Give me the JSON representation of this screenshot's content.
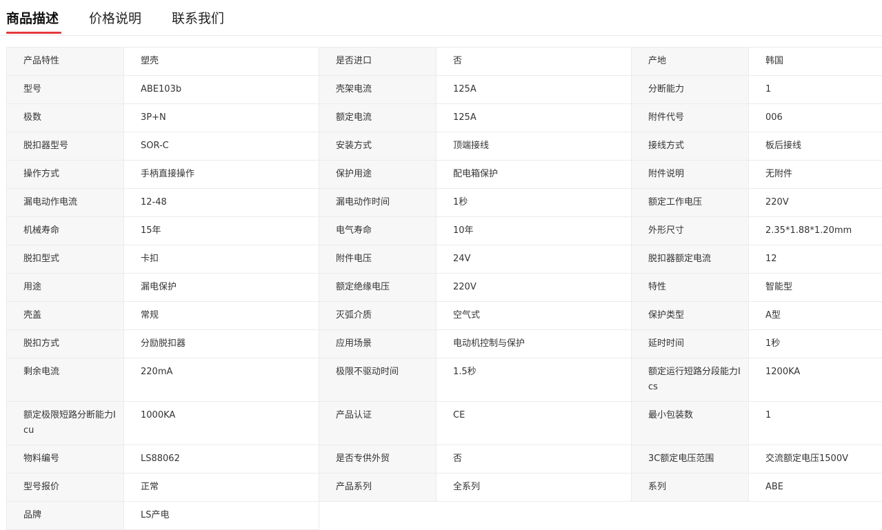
{
  "tabs": [
    {
      "label": "商品描述",
      "active": true
    },
    {
      "label": "价格说明",
      "active": false
    },
    {
      "label": "联系我们",
      "active": false
    }
  ],
  "accent_color": "#e4393c",
  "specs": [
    [
      [
        "产品特性",
        "塑壳"
      ],
      [
        "是否进口",
        "否"
      ],
      [
        "产地",
        "韩国"
      ]
    ],
    [
      [
        "型号",
        "ABE103b"
      ],
      [
        "壳架电流",
        "125A"
      ],
      [
        "分断能力",
        "1"
      ]
    ],
    [
      [
        "极数",
        "3P+N"
      ],
      [
        "额定电流",
        "125A"
      ],
      [
        "附件代号",
        "006"
      ]
    ],
    [
      [
        "脱扣器型号",
        "SOR-C"
      ],
      [
        "安装方式",
        "顶端接线"
      ],
      [
        "接线方式",
        "板后接线"
      ]
    ],
    [
      [
        "操作方式",
        "手柄直接操作"
      ],
      [
        "保护用途",
        "配电箱保护"
      ],
      [
        "附件说明",
        "无附件"
      ]
    ],
    [
      [
        "漏电动作电流",
        "12-48"
      ],
      [
        "漏电动作时间",
        "1秒"
      ],
      [
        "额定工作电压",
        "220V"
      ]
    ],
    [
      [
        "机械寿命",
        "15年"
      ],
      [
        "电气寿命",
        "10年"
      ],
      [
        "外形尺寸",
        "2.35*1.88*1.20mm"
      ]
    ],
    [
      [
        "脱扣型式",
        "卡扣"
      ],
      [
        "附件电压",
        "24V"
      ],
      [
        "脱扣器额定电流",
        "12"
      ]
    ],
    [
      [
        "用途",
        "漏电保护"
      ],
      [
        "额定绝缘电压",
        "220V"
      ],
      [
        "特性",
        "智能型"
      ]
    ],
    [
      [
        "壳盖",
        "常规"
      ],
      [
        "灭弧介质",
        "空气式"
      ],
      [
        "保护类型",
        "A型"
      ]
    ],
    [
      [
        "脱扣方式",
        "分励脱扣器"
      ],
      [
        "应用场景",
        "电动机控制与保护"
      ],
      [
        "延时时间",
        "1秒"
      ]
    ],
    [
      [
        "剩余电流",
        "220mA"
      ],
      [
        "极限不驱动时间",
        "1.5秒"
      ],
      [
        "额定运行短路分段能力Ics",
        "1200KA"
      ]
    ],
    [
      [
        "额定极限短路分断能力Icu",
        "1000KA"
      ],
      [
        "产品认证",
        "CE"
      ],
      [
        "最小包装数",
        "1"
      ]
    ],
    [
      [
        "物料编号",
        "LS88062"
      ],
      [
        "是否专供外贸",
        "否"
      ],
      [
        "3C额定电压范围",
        "交流额定电压1500V"
      ]
    ],
    [
      [
        "型号报价",
        "正常"
      ],
      [
        "产品系列",
        "全系列"
      ],
      [
        "系列",
        "ABE"
      ]
    ],
    [
      [
        "品牌",
        "LS产电"
      ]
    ]
  ]
}
